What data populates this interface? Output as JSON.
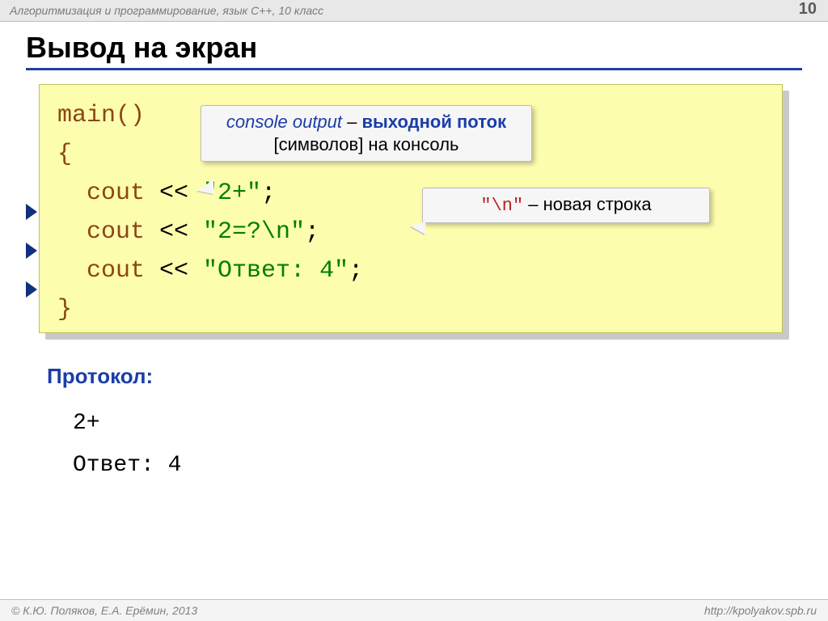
{
  "header": {
    "course": "Алгоритмизация и программирование, язык  C++, 10 класс",
    "page_number": "10"
  },
  "title": "Вывод на экран",
  "code": {
    "line_main": "main()",
    "brace_open": "{",
    "cout_kw": "cout",
    "op": " << ",
    "str1": "\"2+\"",
    "str2": "\"2=?\\n\"",
    "str3": "\"Ответ: 4\"",
    "semicolon": ";",
    "brace_close": "}"
  },
  "callout1": {
    "lead_italic": "console output",
    "dash": " – ",
    "bold1": "выходной поток",
    "plain": " [символов] на консоль"
  },
  "callout2": {
    "mono": "\"\\n\"",
    "rest": " – новая строка"
  },
  "protocol": {
    "label": "Протокол:",
    "line1": "2+",
    "line2": "Ответ: 4"
  },
  "footer": {
    "credit": "© К.Ю. Поляков, Е.А. Ерёмин, 2013",
    "url": "http://kpolyakov.spb.ru"
  }
}
